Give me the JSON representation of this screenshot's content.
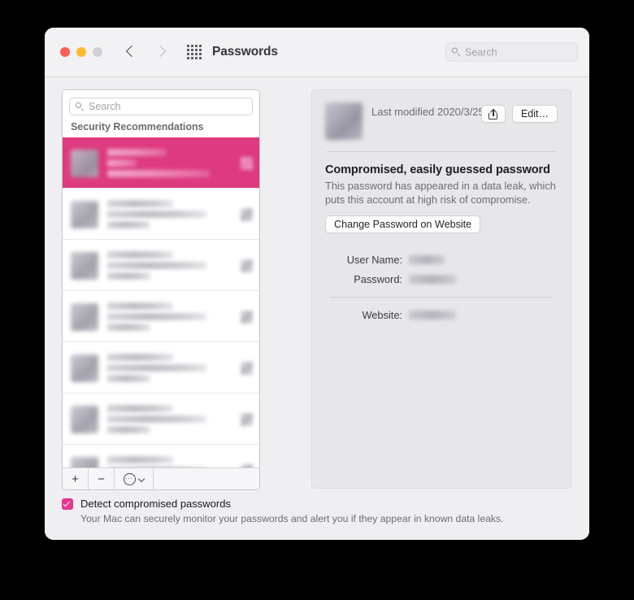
{
  "window": {
    "title": "Passwords",
    "traffic_lights": [
      "close-button",
      "minimize-button",
      "zoom-button"
    ],
    "back_label": "Back",
    "forward_label": "Forward",
    "apps_grid_icon": "grid-icon"
  },
  "toolbar_search": {
    "placeholder": "Search",
    "value": "",
    "icon": "search-icon"
  },
  "sidebar": {
    "search": {
      "placeholder": "Search",
      "value": "",
      "icon": "search-icon"
    },
    "section_header": "Security Recommendations",
    "rows": [
      {
        "selected": true,
        "redacted": true
      },
      {
        "selected": false,
        "redacted": true
      },
      {
        "selected": false,
        "redacted": true
      },
      {
        "selected": false,
        "redacted": true
      },
      {
        "selected": false,
        "redacted": true
      },
      {
        "selected": false,
        "redacted": true
      },
      {
        "selected": false,
        "redacted": true
      }
    ],
    "footer": {
      "add_label": "+",
      "remove_label": "−",
      "more_icon": "circle-ellipsis-icon",
      "more_chevron_icon": "chevron-down-icon"
    }
  },
  "detail": {
    "title_redacted": true,
    "last_modified": "Last modified 2020/3/25",
    "share_icon": "share-icon",
    "edit_label": "Edit…",
    "warning_title": "Compromised, easily guessed password",
    "warning_desc": "This password has appeared in a data leak, which puts this account at high risk of compromise.",
    "change_password_label": "Change Password on Website",
    "fields": [
      {
        "label": "User Name:",
        "value_redacted": true
      },
      {
        "label": "Password:",
        "value_redacted": true
      },
      {
        "label": "Website:",
        "value_redacted": true
      }
    ]
  },
  "bottom": {
    "checkbox_checked": true,
    "checkbox_label": "Detect compromised passwords",
    "description": "Your Mac can securely monitor your passwords and alert you if they appear in known data leaks."
  },
  "colors": {
    "accent_pink": "#DE3A80",
    "checkbox_pink": "#E8368F",
    "window_bg": "#EFEEF0",
    "titlebar_bg": "#F2F1F3",
    "detail_bg": "#E7E6E9",
    "list_bg": "#FFFFFF",
    "page_bg": "#000000"
  }
}
